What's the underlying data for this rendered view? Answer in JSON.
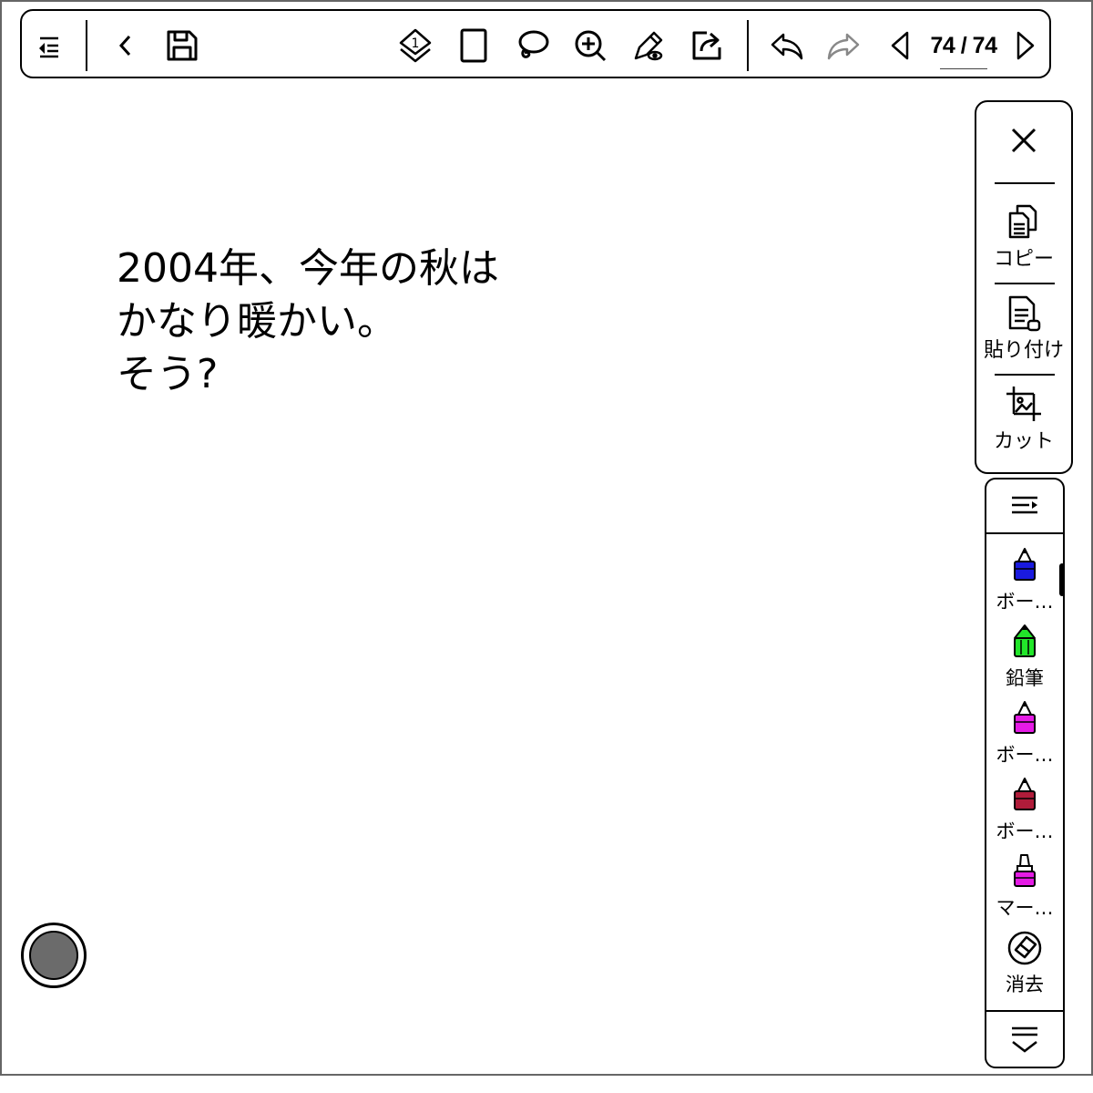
{
  "toolbar": {
    "icons": [
      "toc-icon",
      "back-icon",
      "save-icon",
      "layers-icon",
      "page-template-icon",
      "lasso-icon",
      "zoom-in-icon",
      "pen-settings-icon",
      "share-icon",
      "undo-icon",
      "redo-icon",
      "prev-page-icon",
      "next-page-icon"
    ],
    "layer_number": "1",
    "page_indicator": "74 / 74"
  },
  "canvas": {
    "lines": [
      "2004年、今年の秋は",
      "かなり暖かい。",
      "そう?"
    ]
  },
  "selection_menu": {
    "close_icon": "close-icon",
    "copy_label": "コピー",
    "paste_label": "貼り付け",
    "cut_label": "カット"
  },
  "tool_palette": {
    "menu_icon": "palette-menu-icon",
    "collapse_icon": "collapse-icon",
    "tools": [
      {
        "label": "ボー…",
        "kind": "ballpoint",
        "color": "#1a1adf"
      },
      {
        "label": "鉛筆",
        "kind": "pencil",
        "color": "#22e62a"
      },
      {
        "label": "ボー…",
        "kind": "ballpoint",
        "color": "#e51be5"
      },
      {
        "label": "ボー…",
        "kind": "ballpoint",
        "color": "#b01c3a"
      },
      {
        "label": "マー…",
        "kind": "marker",
        "color": "#e51be5"
      },
      {
        "label": "消去",
        "kind": "eraser",
        "color": "#ffffff"
      }
    ]
  },
  "floating_button": {
    "icon": "floating-shortcut-icon",
    "color": "#6b6b6b"
  }
}
